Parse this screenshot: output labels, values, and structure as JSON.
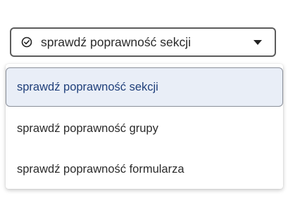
{
  "select": {
    "value": "sprawdź poprawność sekcji",
    "icon": "check-circle-icon",
    "caret_icon": "caret-down-icon"
  },
  "menu": {
    "items": [
      {
        "label": "sprawdź poprawność sekcji",
        "selected": true
      },
      {
        "label": "sprawdź poprawność grupy",
        "selected": false
      },
      {
        "label": "sprawdź poprawność formularza",
        "selected": false
      }
    ]
  },
  "colors": {
    "selected_bg": "#e9eef7",
    "selected_text": "#1f3f7a",
    "border": "#5c5c5c"
  }
}
